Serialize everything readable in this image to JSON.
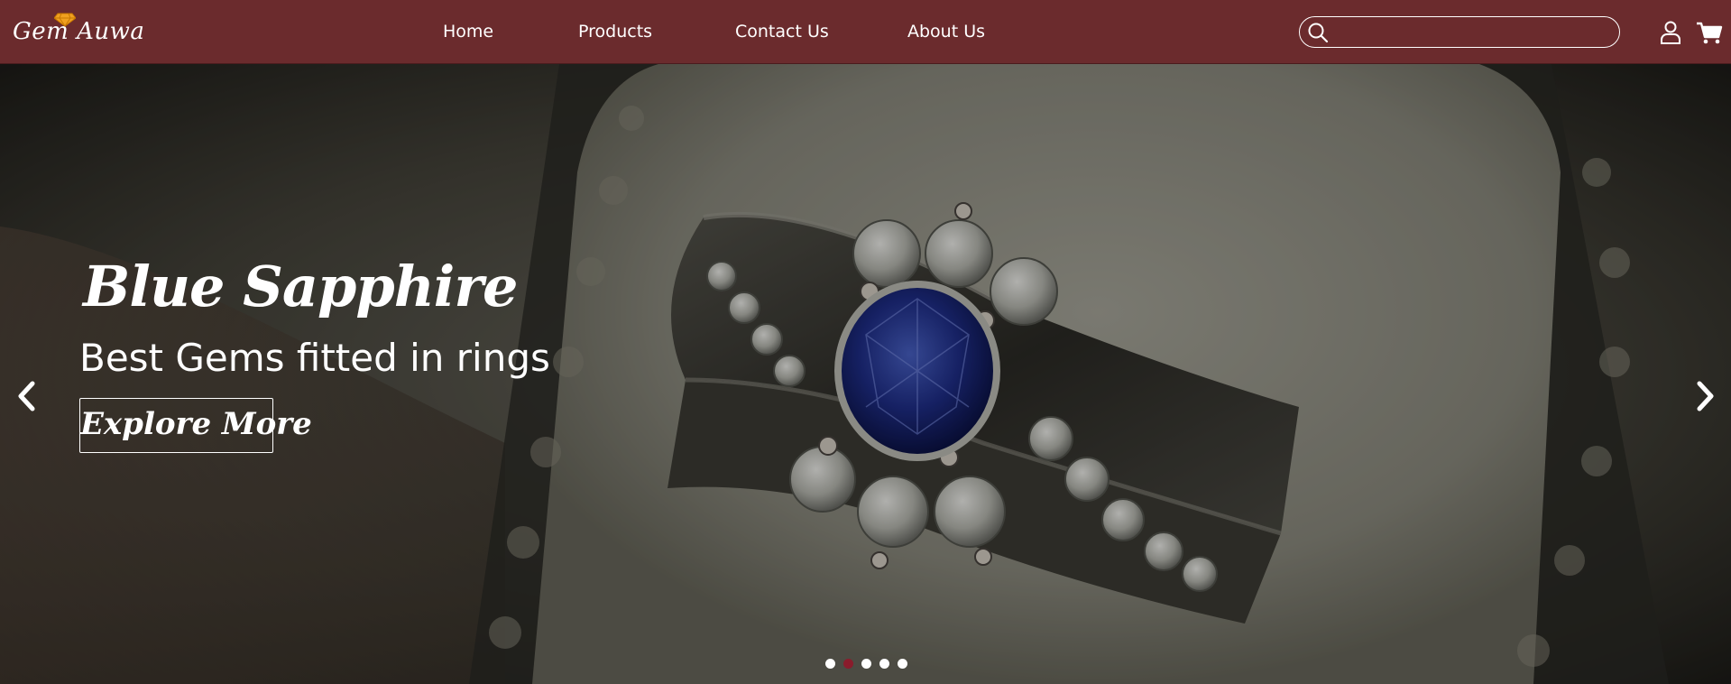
{
  "brand": {
    "logo_text": "Gem Auwa",
    "accent_color": "#6b2b2d",
    "gem_color": "#f0a020"
  },
  "nav": {
    "items": [
      {
        "label": "Home"
      },
      {
        "label": "Products"
      },
      {
        "label": "Contact Us"
      },
      {
        "label": "About Us"
      }
    ]
  },
  "search": {
    "value": "",
    "placeholder": "",
    "icon": "search-icon"
  },
  "header_icons": [
    "user-icon",
    "cart-icon"
  ],
  "hero": {
    "title": "Blue Sapphire",
    "subtitle": "Best Gems fitted in rings",
    "cta_label": "Explore More",
    "prev_icon": "chevron-left-icon",
    "next_icon": "chevron-right-icon",
    "slide_count": 5,
    "active_slide": 2,
    "active_dot_color": "#8a1c2c"
  }
}
